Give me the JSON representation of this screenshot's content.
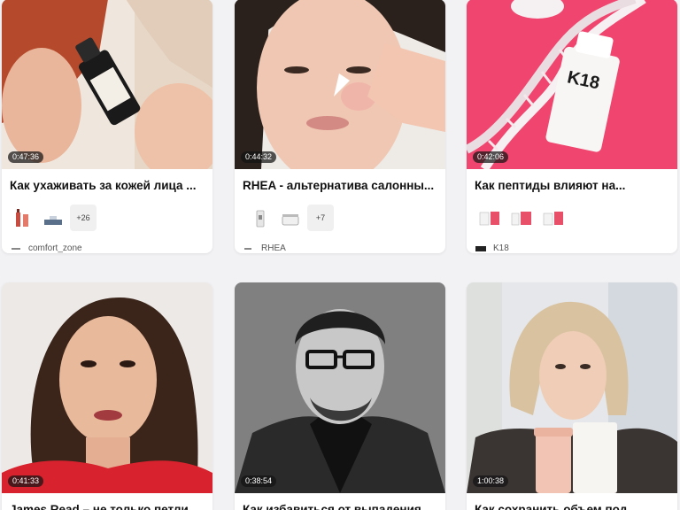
{
  "cards": [
    {
      "duration": "0:47:36",
      "title": "Как ухаживать за кожей лица ...",
      "more": "+26",
      "brand": "comfort_zone",
      "product_icons": [
        "serum-bottle-icon",
        "cream-tube-icon",
        "product-box-icon"
      ]
    },
    {
      "duration": "0:44:32",
      "title": "RHEA - альтернатива салонны...",
      "more": "+7",
      "brand": "RHEA",
      "product_icons": [
        "serum-bottle-icon",
        "cream-jar-icon"
      ]
    },
    {
      "duration": "0:42:06",
      "title": "Как пептиды влияют на...",
      "more": "",
      "brand": "K18",
      "product_icons": [
        "product-box-icon",
        "product-box-icon",
        "product-box-icon"
      ]
    },
    {
      "duration": "0:41:33",
      "title": "James Read – не только петли"
    },
    {
      "duration": "0:38:54",
      "title": "Как избавиться от выпадения"
    },
    {
      "duration": "1:00:38",
      "title": "Как сохранить объем под"
    }
  ],
  "colors": {
    "page_background": "#f2f2f4",
    "card_background": "#ffffff",
    "product_pink": "#e8506a",
    "k18_background": "#f0456e"
  }
}
